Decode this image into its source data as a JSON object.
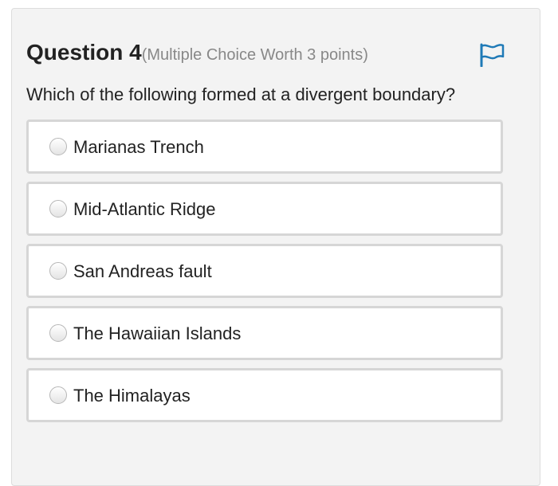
{
  "question": {
    "title": "Question 4",
    "meta": "(Multiple Choice Worth 3 points)",
    "text": "Which of the following formed at a divergent boundary?",
    "flag_icon": "flag-icon",
    "accent_color": "#1f7ab7"
  },
  "options": [
    {
      "label": "Marianas Trench"
    },
    {
      "label": "Mid-Atlantic Ridge"
    },
    {
      "label": "San Andreas fault"
    },
    {
      "label": "The Hawaiian Islands"
    },
    {
      "label": "The Himalayas"
    }
  ]
}
